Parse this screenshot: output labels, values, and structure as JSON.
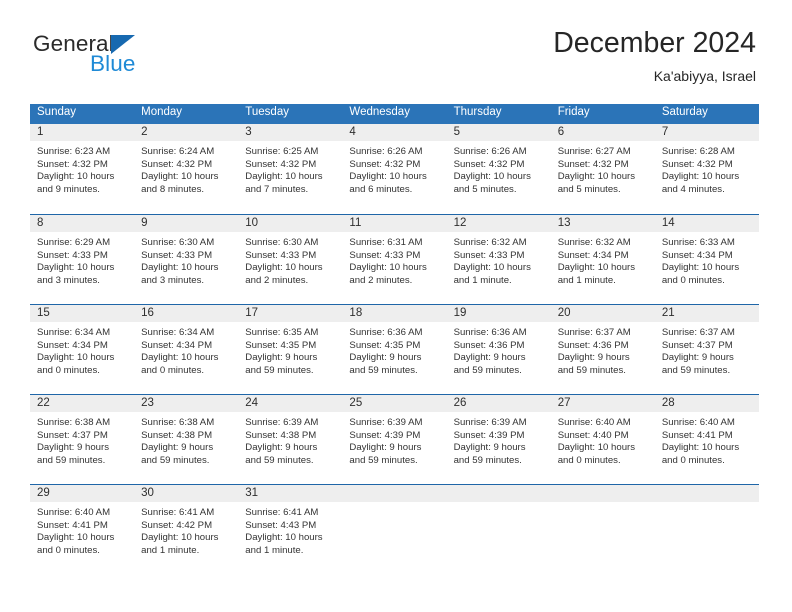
{
  "logo": {
    "word_top": "General",
    "word_bottom": "Blue",
    "triangle_color": "#1769b0",
    "blue_color": "#1f8ad6"
  },
  "header": {
    "title": "December 2024",
    "subtitle": "Ka'abiyya, Israel"
  },
  "theme": {
    "header_blue": "#2b74b8",
    "row_divider_blue": "#1f66a8",
    "day_band_gray": "#eeeeee"
  },
  "weekdays": [
    "Sunday",
    "Monday",
    "Tuesday",
    "Wednesday",
    "Thursday",
    "Friday",
    "Saturday"
  ],
  "weeks": [
    [
      {
        "day": "1",
        "sunrise": "Sunrise: 6:23 AM",
        "sunset": "Sunset: 4:32 PM",
        "daylight_l1": "Daylight: 10 hours",
        "daylight_l2": "and 9 minutes."
      },
      {
        "day": "2",
        "sunrise": "Sunrise: 6:24 AM",
        "sunset": "Sunset: 4:32 PM",
        "daylight_l1": "Daylight: 10 hours",
        "daylight_l2": "and 8 minutes."
      },
      {
        "day": "3",
        "sunrise": "Sunrise: 6:25 AM",
        "sunset": "Sunset: 4:32 PM",
        "daylight_l1": "Daylight: 10 hours",
        "daylight_l2": "and 7 minutes."
      },
      {
        "day": "4",
        "sunrise": "Sunrise: 6:26 AM",
        "sunset": "Sunset: 4:32 PM",
        "daylight_l1": "Daylight: 10 hours",
        "daylight_l2": "and 6 minutes."
      },
      {
        "day": "5",
        "sunrise": "Sunrise: 6:26 AM",
        "sunset": "Sunset: 4:32 PM",
        "daylight_l1": "Daylight: 10 hours",
        "daylight_l2": "and 5 minutes."
      },
      {
        "day": "6",
        "sunrise": "Sunrise: 6:27 AM",
        "sunset": "Sunset: 4:32 PM",
        "daylight_l1": "Daylight: 10 hours",
        "daylight_l2": "and 5 minutes."
      },
      {
        "day": "7",
        "sunrise": "Sunrise: 6:28 AM",
        "sunset": "Sunset: 4:32 PM",
        "daylight_l1": "Daylight: 10 hours",
        "daylight_l2": "and 4 minutes."
      }
    ],
    [
      {
        "day": "8",
        "sunrise": "Sunrise: 6:29 AM",
        "sunset": "Sunset: 4:33 PM",
        "daylight_l1": "Daylight: 10 hours",
        "daylight_l2": "and 3 minutes."
      },
      {
        "day": "9",
        "sunrise": "Sunrise: 6:30 AM",
        "sunset": "Sunset: 4:33 PM",
        "daylight_l1": "Daylight: 10 hours",
        "daylight_l2": "and 3 minutes."
      },
      {
        "day": "10",
        "sunrise": "Sunrise: 6:30 AM",
        "sunset": "Sunset: 4:33 PM",
        "daylight_l1": "Daylight: 10 hours",
        "daylight_l2": "and 2 minutes."
      },
      {
        "day": "11",
        "sunrise": "Sunrise: 6:31 AM",
        "sunset": "Sunset: 4:33 PM",
        "daylight_l1": "Daylight: 10 hours",
        "daylight_l2": "and 2 minutes."
      },
      {
        "day": "12",
        "sunrise": "Sunrise: 6:32 AM",
        "sunset": "Sunset: 4:33 PM",
        "daylight_l1": "Daylight: 10 hours",
        "daylight_l2": "and 1 minute."
      },
      {
        "day": "13",
        "sunrise": "Sunrise: 6:32 AM",
        "sunset": "Sunset: 4:34 PM",
        "daylight_l1": "Daylight: 10 hours",
        "daylight_l2": "and 1 minute."
      },
      {
        "day": "14",
        "sunrise": "Sunrise: 6:33 AM",
        "sunset": "Sunset: 4:34 PM",
        "daylight_l1": "Daylight: 10 hours",
        "daylight_l2": "and 0 minutes."
      }
    ],
    [
      {
        "day": "15",
        "sunrise": "Sunrise: 6:34 AM",
        "sunset": "Sunset: 4:34 PM",
        "daylight_l1": "Daylight: 10 hours",
        "daylight_l2": "and 0 minutes."
      },
      {
        "day": "16",
        "sunrise": "Sunrise: 6:34 AM",
        "sunset": "Sunset: 4:34 PM",
        "daylight_l1": "Daylight: 10 hours",
        "daylight_l2": "and 0 minutes."
      },
      {
        "day": "17",
        "sunrise": "Sunrise: 6:35 AM",
        "sunset": "Sunset: 4:35 PM",
        "daylight_l1": "Daylight: 9 hours",
        "daylight_l2": "and 59 minutes."
      },
      {
        "day": "18",
        "sunrise": "Sunrise: 6:36 AM",
        "sunset": "Sunset: 4:35 PM",
        "daylight_l1": "Daylight: 9 hours",
        "daylight_l2": "and 59 minutes."
      },
      {
        "day": "19",
        "sunrise": "Sunrise: 6:36 AM",
        "sunset": "Sunset: 4:36 PM",
        "daylight_l1": "Daylight: 9 hours",
        "daylight_l2": "and 59 minutes."
      },
      {
        "day": "20",
        "sunrise": "Sunrise: 6:37 AM",
        "sunset": "Sunset: 4:36 PM",
        "daylight_l1": "Daylight: 9 hours",
        "daylight_l2": "and 59 minutes."
      },
      {
        "day": "21",
        "sunrise": "Sunrise: 6:37 AM",
        "sunset": "Sunset: 4:37 PM",
        "daylight_l1": "Daylight: 9 hours",
        "daylight_l2": "and 59 minutes."
      }
    ],
    [
      {
        "day": "22",
        "sunrise": "Sunrise: 6:38 AM",
        "sunset": "Sunset: 4:37 PM",
        "daylight_l1": "Daylight: 9 hours",
        "daylight_l2": "and 59 minutes."
      },
      {
        "day": "23",
        "sunrise": "Sunrise: 6:38 AM",
        "sunset": "Sunset: 4:38 PM",
        "daylight_l1": "Daylight: 9 hours",
        "daylight_l2": "and 59 minutes."
      },
      {
        "day": "24",
        "sunrise": "Sunrise: 6:39 AM",
        "sunset": "Sunset: 4:38 PM",
        "daylight_l1": "Daylight: 9 hours",
        "daylight_l2": "and 59 minutes."
      },
      {
        "day": "25",
        "sunrise": "Sunrise: 6:39 AM",
        "sunset": "Sunset: 4:39 PM",
        "daylight_l1": "Daylight: 9 hours",
        "daylight_l2": "and 59 minutes."
      },
      {
        "day": "26",
        "sunrise": "Sunrise: 6:39 AM",
        "sunset": "Sunset: 4:39 PM",
        "daylight_l1": "Daylight: 9 hours",
        "daylight_l2": "and 59 minutes."
      },
      {
        "day": "27",
        "sunrise": "Sunrise: 6:40 AM",
        "sunset": "Sunset: 4:40 PM",
        "daylight_l1": "Daylight: 10 hours",
        "daylight_l2": "and 0 minutes."
      },
      {
        "day": "28",
        "sunrise": "Sunrise: 6:40 AM",
        "sunset": "Sunset: 4:41 PM",
        "daylight_l1": "Daylight: 10 hours",
        "daylight_l2": "and 0 minutes."
      }
    ],
    [
      {
        "day": "29",
        "sunrise": "Sunrise: 6:40 AM",
        "sunset": "Sunset: 4:41 PM",
        "daylight_l1": "Daylight: 10 hours",
        "daylight_l2": "and 0 minutes."
      },
      {
        "day": "30",
        "sunrise": "Sunrise: 6:41 AM",
        "sunset": "Sunset: 4:42 PM",
        "daylight_l1": "Daylight: 10 hours",
        "daylight_l2": "and 1 minute."
      },
      {
        "day": "31",
        "sunrise": "Sunrise: 6:41 AM",
        "sunset": "Sunset: 4:43 PM",
        "daylight_l1": "Daylight: 10 hours",
        "daylight_l2": "and 1 minute."
      },
      {
        "day": "",
        "sunrise": "",
        "sunset": "",
        "daylight_l1": "",
        "daylight_l2": ""
      },
      {
        "day": "",
        "sunrise": "",
        "sunset": "",
        "daylight_l1": "",
        "daylight_l2": ""
      },
      {
        "day": "",
        "sunrise": "",
        "sunset": "",
        "daylight_l1": "",
        "daylight_l2": ""
      },
      {
        "day": "",
        "sunrise": "",
        "sunset": "",
        "daylight_l1": "",
        "daylight_l2": ""
      }
    ]
  ]
}
